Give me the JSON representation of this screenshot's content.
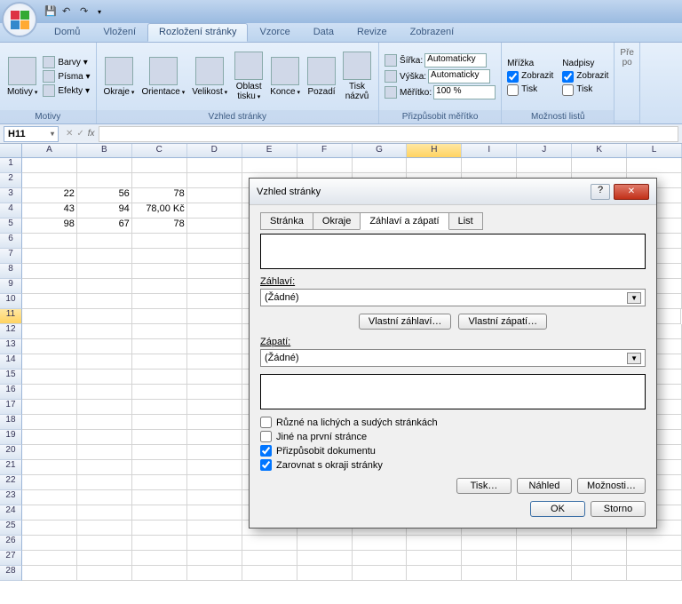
{
  "qat": {
    "save": "💾",
    "undo": "↶",
    "redo": "↷"
  },
  "tabs": {
    "home": "Domů",
    "insert": "Vložení",
    "layout": "Rozložení stránky",
    "formulas": "Vzorce",
    "data": "Data",
    "review": "Revize",
    "view": "Zobrazení"
  },
  "ribbon": {
    "themes": {
      "motivy": "Motivy",
      "barvy": "Barvy ▾",
      "pisma": "Písma ▾",
      "efekty": "Efekty ▾",
      "label": "Motivy"
    },
    "page": {
      "okraje": "Okraje",
      "orientace": "Orientace",
      "velikost": "Velikost",
      "oblast": "Oblast\ntisku",
      "konce": "Konce",
      "pozadi": "Pozadí",
      "tisknazvu": "Tisk\nnázvů",
      "label": "Vzhled stránky"
    },
    "scale": {
      "sirka": "Šířka:",
      "vyska": "Výška:",
      "meritko": "Měřítko:",
      "auto": "Automaticky",
      "pct": "100 %",
      "label": "Přizpůsobit měřítko"
    },
    "sheet": {
      "mrizka": "Mřížka",
      "nadpisy": "Nadpisy",
      "zobrazit": "Zobrazit",
      "tisk": "Tisk",
      "label": "Možnosti listů"
    },
    "arrange": {
      "pren": "Pře",
      "pos": "po"
    }
  },
  "cellref": "H11",
  "columns": [
    "A",
    "B",
    "C",
    "D",
    "E",
    "F",
    "G",
    "H",
    "I",
    "J",
    "K",
    "L"
  ],
  "cells": {
    "r3": {
      "A": "22",
      "B": "56",
      "C": "78"
    },
    "r4": {
      "A": "43",
      "B": "94",
      "C": "78,00 Kč"
    },
    "r5": {
      "A": "98",
      "B": "67",
      "C": "78"
    }
  },
  "cursor": {
    "col": "H",
    "row": 11
  },
  "dialog": {
    "title": "Vzhled stránky",
    "tabs": {
      "stranka": "Stránka",
      "okraje": "Okraje",
      "zahlavi": "Záhlaví a zápatí",
      "list": "List"
    },
    "zahlavi_label": "Záhlaví:",
    "zapati_label": "Zápatí:",
    "none": "(Žádné)",
    "vlastni_zahlavi": "Vlastní záhlaví…",
    "vlastni_zapati": "Vlastní zápatí…",
    "ck1": "Různé na lichých a sudých stránkách",
    "ck2": "Jiné na první stránce",
    "ck3": "Přizpůsobit dokumentu",
    "ck4": "Zarovnat s okraji stránky",
    "tisk": "Tisk…",
    "nahled": "Náhled",
    "moznosti": "Možnosti…",
    "ok": "OK",
    "storno": "Storno"
  }
}
